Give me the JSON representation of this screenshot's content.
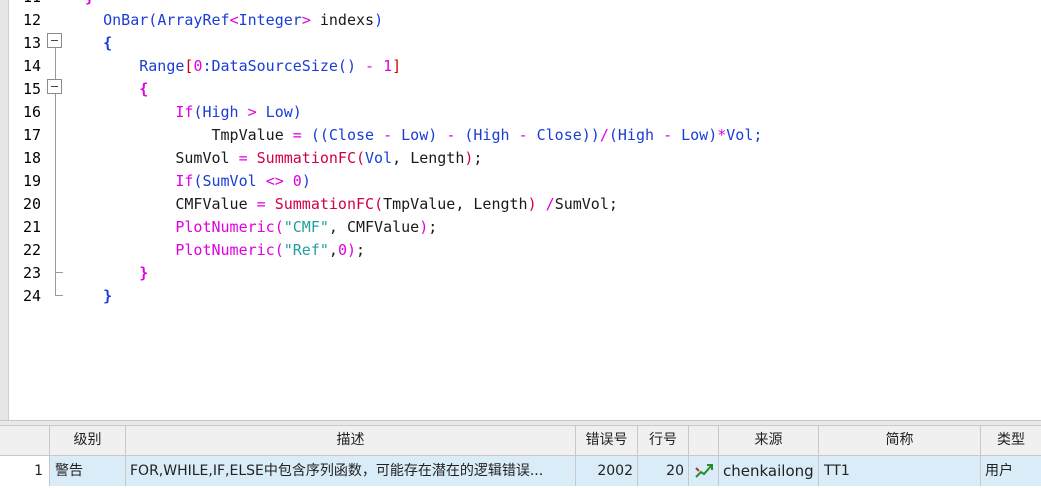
{
  "editor": {
    "lines": [
      {
        "num": "12",
        "indent": "  ",
        "tokens": [
          [
            "fn",
            "OnBar"
          ],
          [
            "fn",
            "("
          ],
          [
            "ty",
            "ArrayRef"
          ],
          [
            "op",
            "<"
          ],
          [
            "ty",
            "Integer"
          ],
          [
            "op",
            ">"
          ],
          [
            "id",
            " indexs"
          ],
          [
            "fn",
            ")"
          ]
        ]
      },
      {
        "num": "13",
        "indent": "  ",
        "tokens": [
          [
            "br",
            "{"
          ]
        ]
      },
      {
        "num": "14",
        "indent": "    ",
        "tokens": [
          [
            "fn",
            "Range"
          ],
          [
            "rg",
            "["
          ],
          [
            "num",
            "0"
          ],
          [
            "fn",
            ":DataSourceSize() "
          ],
          [
            "op",
            "-"
          ],
          [
            "num",
            " 1"
          ],
          [
            "rg",
            "]"
          ]
        ]
      },
      {
        "num": "15",
        "indent": "    ",
        "tokens": [
          [
            "br2",
            "{"
          ]
        ]
      },
      {
        "num": "16",
        "indent": "      ",
        "tokens": [
          [
            "kw",
            "If"
          ],
          [
            "fn",
            "(High "
          ],
          [
            "op",
            ">"
          ],
          [
            "fn",
            " Low)"
          ]
        ]
      },
      {
        "num": "17",
        "indent": "        ",
        "tokens": [
          [
            "id",
            "TmpValue "
          ],
          [
            "op",
            "="
          ],
          [
            "fn",
            " ((Close "
          ],
          [
            "op",
            "-"
          ],
          [
            "fn",
            " Low) "
          ],
          [
            "op",
            "-"
          ],
          [
            "fn",
            " (High "
          ],
          [
            "op",
            "-"
          ],
          [
            "fn",
            " Close))"
          ],
          [
            "op",
            "/"
          ],
          [
            "fn",
            "(High "
          ],
          [
            "op",
            "-"
          ],
          [
            "fn",
            " Low)"
          ],
          [
            "op",
            "*"
          ],
          [
            "fn",
            "Vol;"
          ]
        ]
      },
      {
        "num": "18",
        "indent": "      ",
        "tokens": [
          [
            "id",
            "SumVol "
          ],
          [
            "op",
            "="
          ],
          [
            "lib",
            " SummationFC"
          ],
          [
            "lib",
            "("
          ],
          [
            "fn",
            "Vol"
          ],
          [
            "id",
            ", "
          ],
          [
            "id",
            "Length"
          ],
          [
            "lib",
            ")"
          ],
          [
            "id",
            ";"
          ]
        ]
      },
      {
        "num": "19",
        "indent": "      ",
        "tokens": [
          [
            "kw",
            "If"
          ],
          [
            "fn",
            "(SumVol "
          ],
          [
            "op",
            "<>"
          ],
          [
            "num",
            " 0"
          ],
          [
            "fn",
            ")"
          ]
        ]
      },
      {
        "num": "20",
        "indent": "      ",
        "tokens": [
          [
            "id",
            "CMFValue "
          ],
          [
            "op",
            "="
          ],
          [
            "lib",
            " SummationFC"
          ],
          [
            "lib",
            "("
          ],
          [
            "id",
            "TmpValue, Length"
          ],
          [
            "lib",
            ")"
          ],
          [
            "op",
            " /"
          ],
          [
            "id",
            "SumVol;"
          ]
        ]
      },
      {
        "num": "21",
        "indent": "      ",
        "tokens": [
          [
            "kw",
            "PlotNumeric"
          ],
          [
            "kw",
            "("
          ],
          [
            "str",
            "\"CMF\""
          ],
          [
            "id",
            ", CMFValue"
          ],
          [
            "kw",
            ")"
          ],
          [
            "id",
            ";"
          ]
        ]
      },
      {
        "num": "22",
        "indent": "      ",
        "tokens": [
          [
            "kw",
            "PlotNumeric"
          ],
          [
            "kw",
            "("
          ],
          [
            "str",
            "\"Ref\""
          ],
          [
            "id",
            ","
          ],
          [
            "num",
            "0"
          ],
          [
            "kw",
            ")"
          ],
          [
            "id",
            ";"
          ]
        ]
      },
      {
        "num": "23",
        "indent": "    ",
        "tokens": [
          [
            "br2",
            "}"
          ]
        ]
      },
      {
        "num": "24",
        "indent": "  ",
        "tokens": [
          [
            "br",
            "}"
          ]
        ]
      }
    ]
  },
  "errors": {
    "headers": {
      "level": "级别",
      "desc": "描述",
      "code": "错误号",
      "line": "行号",
      "icon": "",
      "source": "来源",
      "abbr": "简称",
      "type": "类型"
    },
    "rows": [
      {
        "index": "1",
        "level": "警告",
        "desc": "FOR,WHILE,IF,ELSE中包含序列函数，可能存在潜在的逻辑错误...",
        "code": "2002",
        "line": "20",
        "icon": "edit-arrow-icon",
        "source": "chenkailong",
        "abbr": "TT1",
        "type": "用户"
      }
    ]
  },
  "colors": {
    "function_blue": "#1a3dd6",
    "keyword_magenta": "#e000e0",
    "library_red": "#d0004a",
    "string_teal": "#20a0a0",
    "selected_row": "#d9ecf8"
  }
}
